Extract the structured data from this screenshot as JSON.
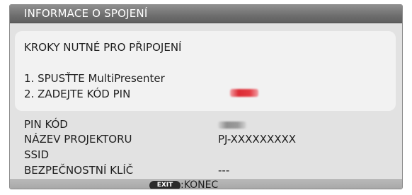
{
  "title": "INFORMACE O SPOJENÍ",
  "steps": {
    "heading": "KROKY NUTNÉ PRO PŘIPOJENÍ",
    "step1": "1. SPUSŤTE MultiPresenter",
    "step2": "2. ZADEJTE KÓD PIN"
  },
  "info": {
    "pin_label": "PIN KÓD",
    "projector_name_label": "NÁZEV PROJEKTORU",
    "projector_name_value": "PJ-XXXXXXXXX",
    "ssid_label": "SSID",
    "security_key_label": "BEZPEČNOSTNÍ KLÍČ",
    "security_key_value": "---"
  },
  "footer": {
    "exit_key": "EXIT",
    "exit_text": ":KONEC"
  },
  "colors": {
    "title_bar": "#6e6e6e",
    "panel_background": "#e2e2e2",
    "steps_background": "#f2f2f2",
    "pin_highlight": "#dc2b34"
  }
}
